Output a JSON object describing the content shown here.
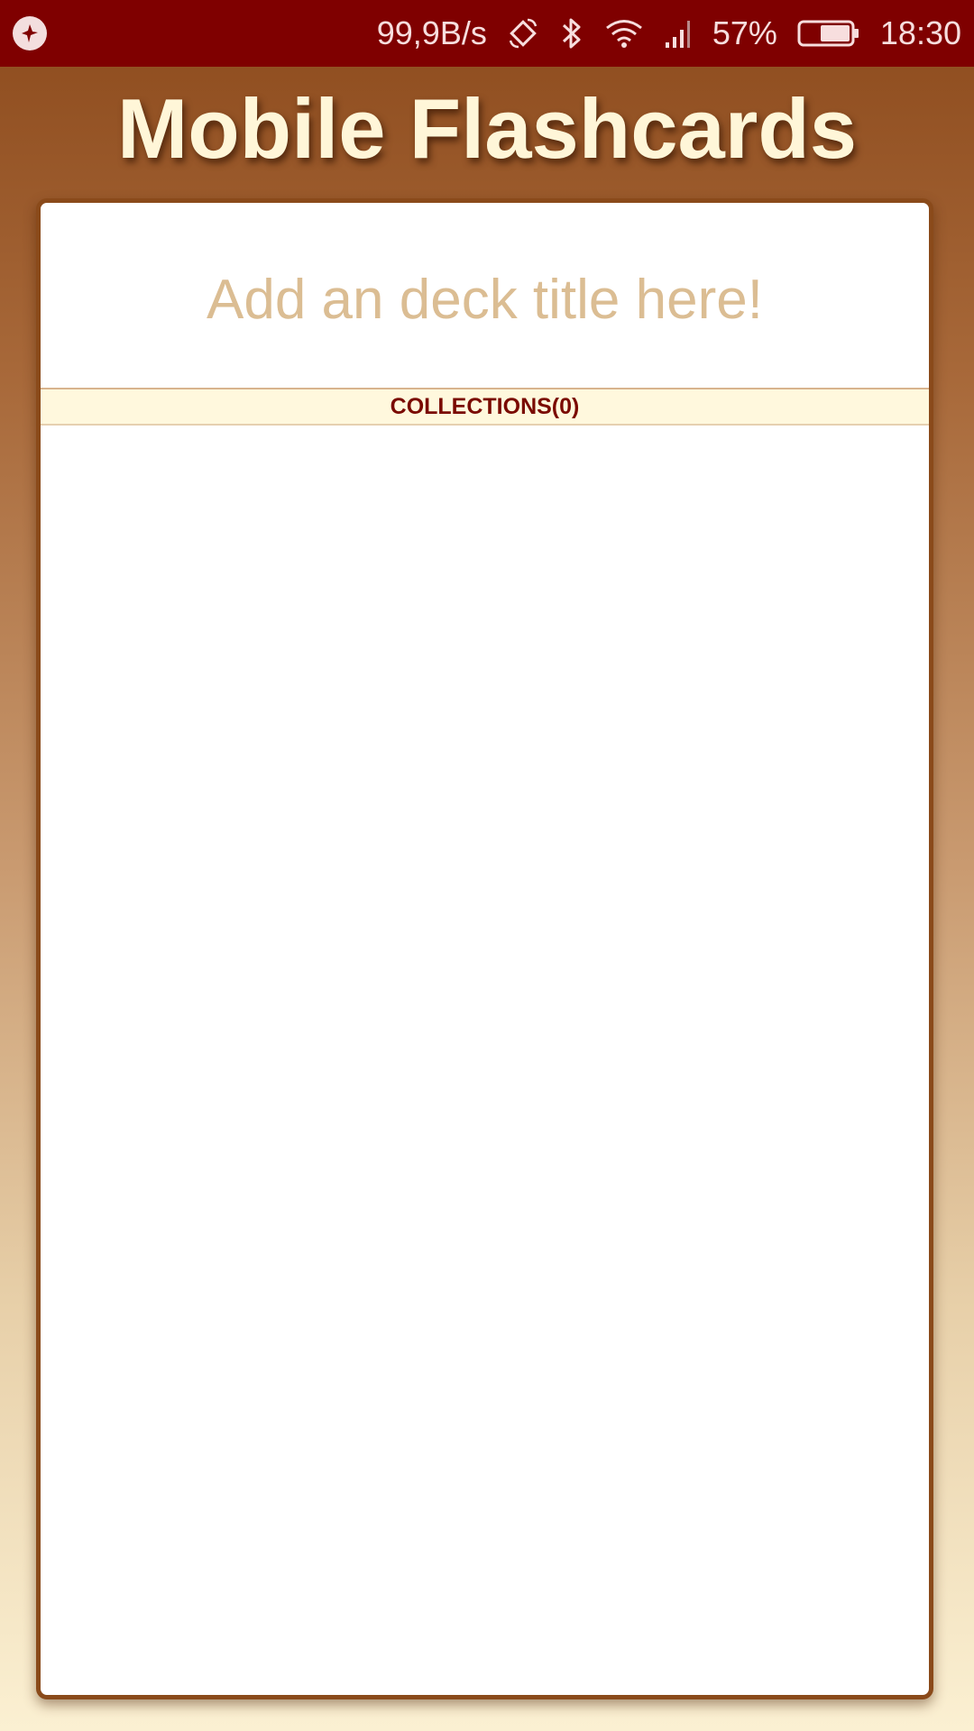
{
  "status_bar": {
    "network_speed": "99,9B/s",
    "battery_percent": "57%",
    "time": "18:30",
    "icons": [
      "app-notification-icon",
      "rotate-icon",
      "bluetooth-icon",
      "wifi-icon",
      "signal-icon",
      "battery-icon"
    ],
    "background_color": "#7f0000"
  },
  "app": {
    "title": "Mobile Flashcards"
  },
  "deck": {
    "title_placeholder": "Add an deck title here!",
    "collections_header": "COLLECTIONS(0)",
    "collections": []
  },
  "colors": {
    "panel_border": "#8a4a1a",
    "title_text": "#fff6d8",
    "placeholder_text": "#dbbd93",
    "collections_text": "#7a0a00",
    "collections_bg": "#fff8dd"
  }
}
